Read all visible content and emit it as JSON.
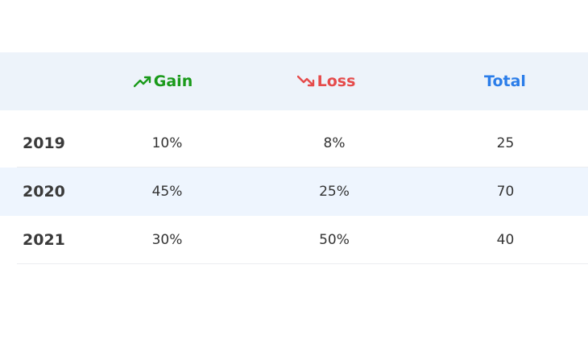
{
  "table": {
    "headers": {
      "year": "",
      "gain": "Gain",
      "loss": "Loss",
      "total": "Total"
    },
    "header_icons": {
      "gain": "trending-up-icon",
      "loss": "trending-down-icon"
    },
    "colors": {
      "gain": "#1a9a1a",
      "loss": "#e54b4b",
      "total": "#2b7de9",
      "header_bg": "#edf3fa",
      "highlight_row_bg": "#eef5fe"
    },
    "rows": [
      {
        "year": "2019",
        "gain": "10%",
        "loss": "8%",
        "total": "25"
      },
      {
        "year": "2020",
        "gain": "45%",
        "loss": "25%",
        "total": "70"
      },
      {
        "year": "2021",
        "gain": "30%",
        "loss": "50%",
        "total": "40"
      }
    ]
  }
}
